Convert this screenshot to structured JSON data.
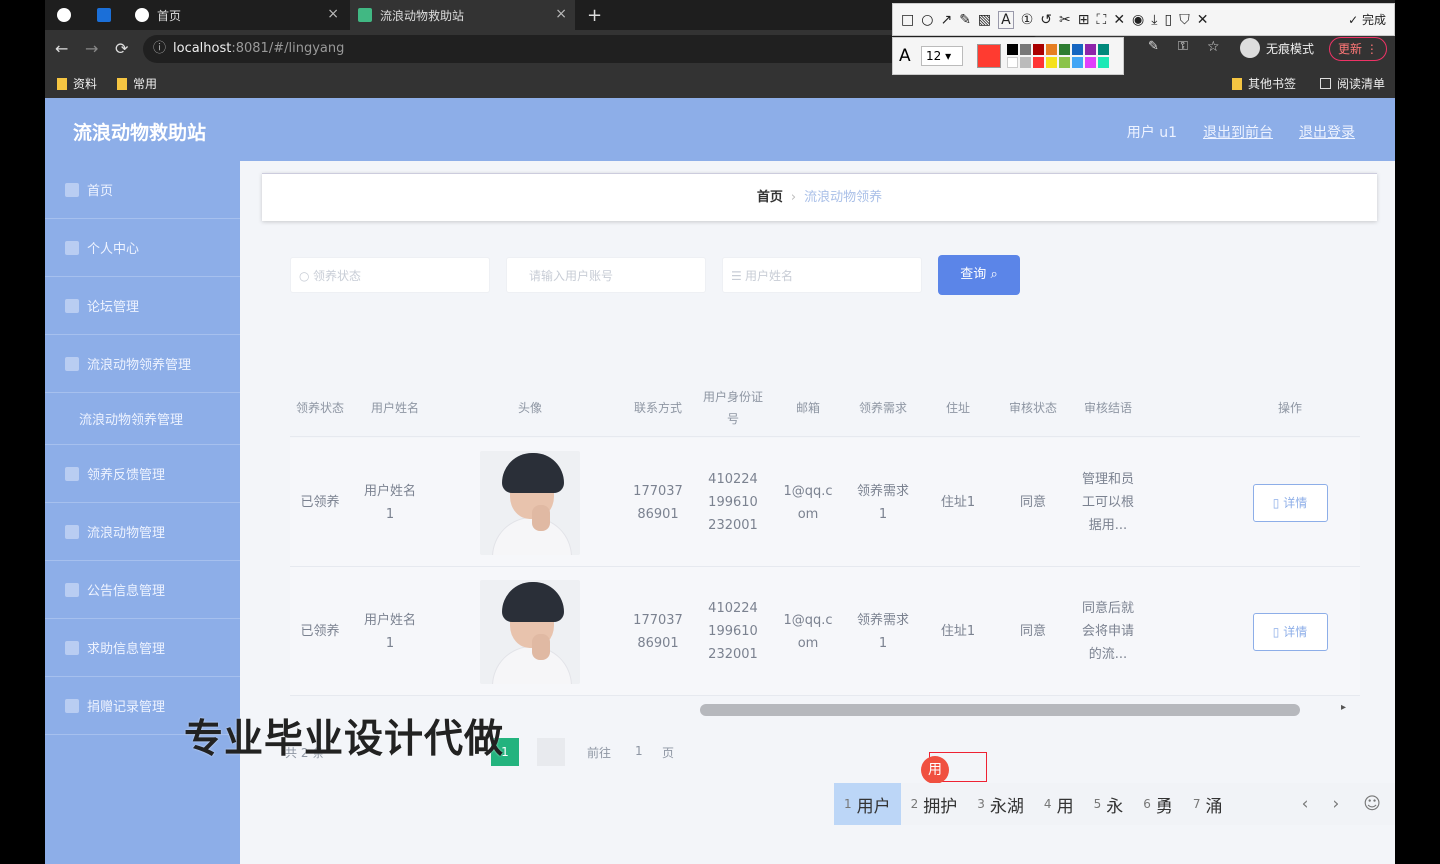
{
  "browser": {
    "tabs": [
      {
        "title": "首页",
        "active": false
      },
      {
        "title": "流浪动物救助站",
        "active": true
      }
    ],
    "url_host": "localhost",
    "url_path": ":8081/#/lingyang",
    "incognito_label": "无痕模式",
    "update_label": "更新",
    "bookmarks": [
      "资料",
      "常用"
    ],
    "bookmarks_right": [
      "其他书签",
      "阅读清单"
    ]
  },
  "annotation_toolbar": {
    "font_size": "12",
    "done_label": "完成",
    "active_color": "#ff3b30"
  },
  "app": {
    "brand": "流浪动物救助站",
    "header_links": [
      "用户 u1",
      "退出到前台",
      "退出登录"
    ],
    "colors": {
      "primary": "#8daee8",
      "button": "#5b85e8",
      "pager_current": "#23b37e"
    }
  },
  "sidebar": {
    "items": [
      {
        "label": "首页",
        "sub": false
      },
      {
        "label": "个人中心",
        "sub": false
      },
      {
        "label": "论坛管理",
        "sub": false
      },
      {
        "label": "流浪动物领养管理",
        "sub": false
      },
      {
        "label": "流浪动物领养管理",
        "sub": true
      },
      {
        "label": "领养反馈管理",
        "sub": false
      },
      {
        "label": "流浪动物管理",
        "sub": false
      },
      {
        "label": "公告信息管理",
        "sub": false
      },
      {
        "label": "求助信息管理",
        "sub": false
      },
      {
        "label": "捐赠记录管理",
        "sub": false
      }
    ]
  },
  "breadcrumb": {
    "home": "首页",
    "current": "流浪动物领养"
  },
  "search": {
    "placeholders": [
      "领养状态",
      "请输入用户账号",
      "用户姓名"
    ],
    "button_label": "查询"
  },
  "table": {
    "headers": [
      "领养状态",
      "用户姓名",
      "头像",
      "联系方式",
      "用户身份证号",
      "邮箱",
      "领养需求",
      "住址",
      "审核状态",
      "审核结语",
      "操作"
    ],
    "rows": [
      {
        "status": "已领养",
        "name": "用户姓名1",
        "phone": "17703786901",
        "idcard": "410224199610232001",
        "email": "1@qq.com",
        "need": "领养需求1",
        "address": "住址1",
        "audit": "同意",
        "remark": "管理和员工可以根据用...",
        "action": "详情"
      },
      {
        "status": "已领养",
        "name": "用户姓名1",
        "phone": "17703786901",
        "idcard": "410224199610232001",
        "email": "1@qq.com",
        "need": "领养需求1",
        "address": "住址1",
        "audit": "同意",
        "remark": "同意后就会将申请的流...",
        "action": "详情"
      }
    ]
  },
  "pager": {
    "total": "共 2 条",
    "current": "1",
    "goto": "前往",
    "page": "1",
    "unit": "页"
  },
  "watermark": "专业毕业设计代做",
  "ime": {
    "composing": "用",
    "candidates": [
      {
        "n": "1",
        "text": "用户"
      },
      {
        "n": "2",
        "text": "拥护"
      },
      {
        "n": "3",
        "text": "永湖"
      },
      {
        "n": "4",
        "text": "用"
      },
      {
        "n": "5",
        "text": "永"
      },
      {
        "n": "6",
        "text": "勇"
      },
      {
        "n": "7",
        "text": "涌"
      }
    ]
  }
}
